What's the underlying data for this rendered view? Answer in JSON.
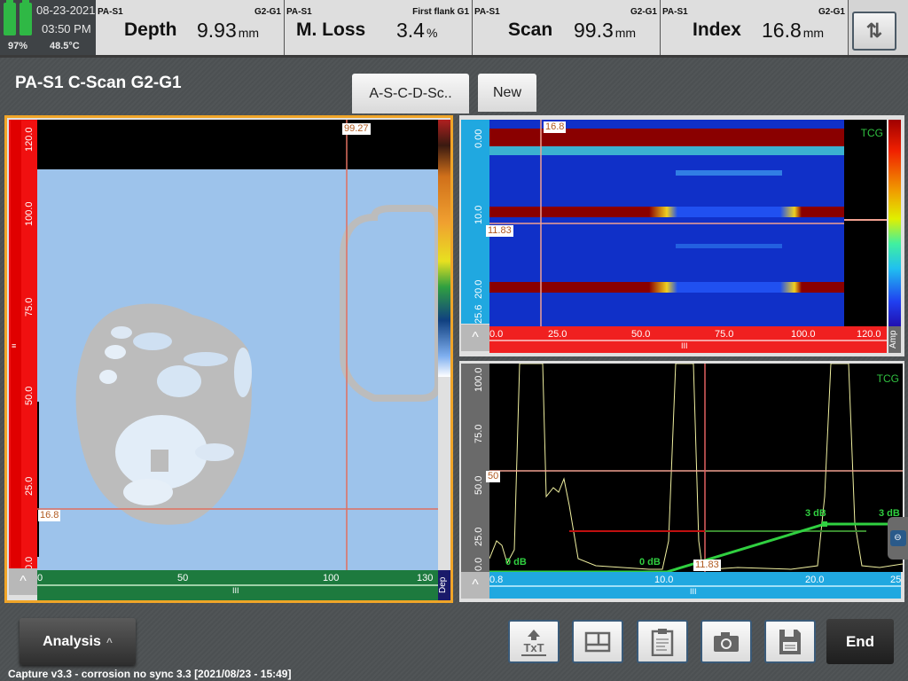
{
  "status": {
    "date": "08-23-2021",
    "time": "03:50 PM",
    "battery": "97%",
    "temperature": "48.5°C"
  },
  "readings": [
    {
      "source": "PA-S1",
      "group": "G2-G1",
      "label": "Depth",
      "value": "9.93",
      "unit": "mm"
    },
    {
      "source": "PA-S1",
      "group": "First flank G1",
      "label": "M. Loss",
      "value": "3.4",
      "unit": "%"
    },
    {
      "source": "PA-S1",
      "group": "G2-G1",
      "label": "Scan",
      "value": "99.3",
      "unit": "mm"
    },
    {
      "source": "PA-S1",
      "group": "G2-G1",
      "label": "Index",
      "value": "16.8",
      "unit": "mm"
    }
  ],
  "header": {
    "title": "PA-S1 C-Scan G2-G1"
  },
  "tabs": [
    {
      "label": "A-S-C-D-Sc..",
      "active": true
    },
    {
      "label": "New",
      "active": false
    }
  ],
  "cscan": {
    "y_ticks": [
      "120.0",
      "100.0",
      "75.0",
      "50.0",
      "25.0",
      "0.0"
    ],
    "x_ticks": [
      "0",
      "50",
      "100",
      "130"
    ],
    "x_unit_label": "Dep",
    "cursor_x_label": "99.27",
    "cursor_y_label": "16.8"
  },
  "dscan": {
    "y_ticks": [
      "0.00",
      "10.0",
      "20.0",
      "25.6"
    ],
    "x_ticks": [
      "0.0",
      "25.0",
      "50.0",
      "75.0",
      "100.0",
      "120.0"
    ],
    "palette_label": "Amp",
    "overlay": "TCG",
    "cursor_x_label": "16.8",
    "cursor_y_label": "11.83"
  },
  "ascan": {
    "y_ticks": [
      "100.0",
      "75.0",
      "50.0",
      "25.0",
      "0.0"
    ],
    "x_ticks": [
      "0.8",
      "10.0",
      "20.0",
      "25"
    ],
    "overlay": "TCG",
    "gate_label": "50",
    "cursor_label": "11.83",
    "tcg_points": [
      "0 dB",
      "0 dB",
      "3 dB",
      "3 dB"
    ]
  },
  "toolbar": {
    "analysis_label": "Analysis",
    "buttons": [
      {
        "icon": "txt-export-icon"
      },
      {
        "icon": "layout-icon"
      },
      {
        "icon": "report-icon"
      },
      {
        "icon": "camera-icon"
      },
      {
        "icon": "save-icon"
      }
    ],
    "end_label": "End"
  },
  "footer": {
    "text": "Capture v3.3 - corrosion no sync 3.3 [2021/08/23 - 15:49]"
  }
}
